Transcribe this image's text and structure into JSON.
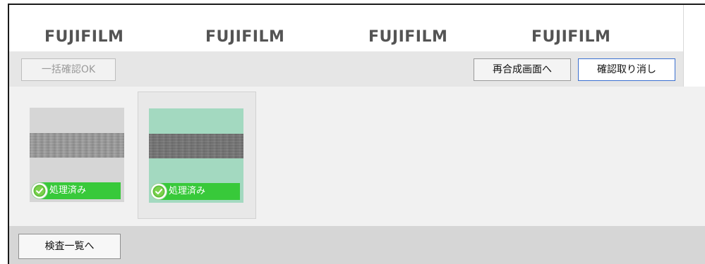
{
  "header": {
    "logos": [
      "FUJIFILM",
      "FUJIFILM",
      "FUJIFILM",
      "FUJIFILM"
    ]
  },
  "toolbar": {
    "bulk_confirm_label": "一括確認OK",
    "recompose_label": "再合成画面へ",
    "cancel_confirm_label": "確認取り消し"
  },
  "items": [
    {
      "status_label": "処理済み",
      "status_icon": "check-circle-icon",
      "selected": false,
      "thumb_bg": "#d6d6d6"
    },
    {
      "status_label": "処理済み",
      "status_icon": "check-circle-icon",
      "selected": true,
      "thumb_bg": "#a3d9c0"
    }
  ],
  "footer": {
    "inspection_list_label": "検査一覧へ"
  },
  "colors": {
    "status_green": "#38c93a",
    "selected_thumb": "#a3d9c0",
    "toolbar_bg": "#e6e6e6",
    "focus_border": "#3a6fd0"
  }
}
